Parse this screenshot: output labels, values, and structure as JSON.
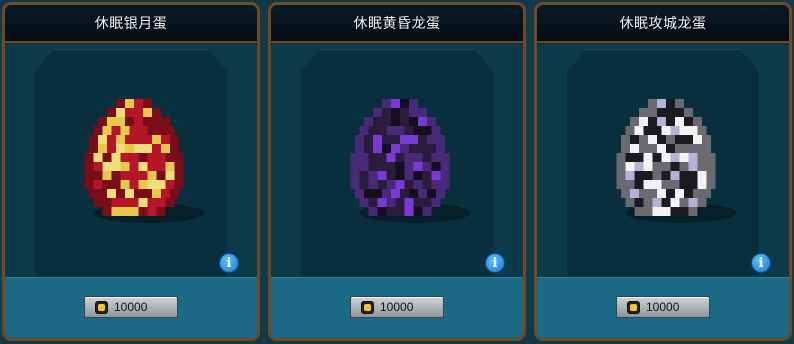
{
  "shop": {
    "items": [
      {
        "title": "休眠银月蛋",
        "price": "10000",
        "palette": [
          "#b5162a",
          "#e6c84a",
          "#7a0d18",
          "#f1de7a"
        ]
      },
      {
        "title": "休眠黄昏龙蛋",
        "price": "10000",
        "palette": [
          "#2a1d3d",
          "#7a3ad6",
          "#4a2a78",
          "#141020"
        ]
      },
      {
        "title": "休眠攻城龙蛋",
        "price": "10000",
        "palette": [
          "#1c1c20",
          "#f2f2f2",
          "#6a6a70",
          "#b7b0d8"
        ]
      }
    ]
  },
  "icons": {
    "info": "i"
  }
}
